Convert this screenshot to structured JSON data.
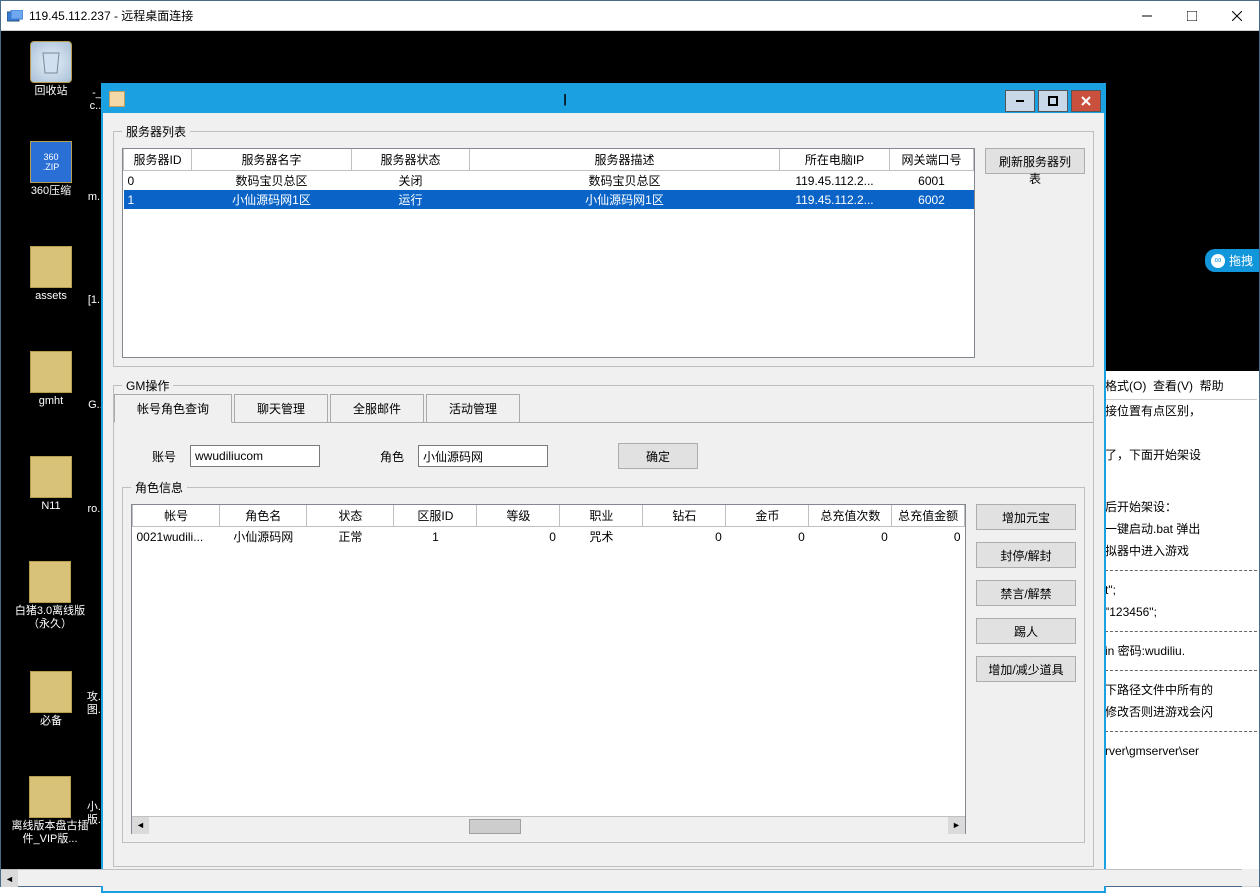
{
  "rdp": {
    "title": "119.45.112.237 - 远程桌面连接"
  },
  "desktop": {
    "recycle": "回收站",
    "zip": "360压缩",
    "assets": "assets",
    "gmht": "gmht",
    "n11": "N11",
    "pig": "白猪3.0离线版（永久）",
    "must": "必备",
    "offline": "离线版本盘古插件_VIP版...",
    "col2a": "-_c...",
    "col2b": "m...",
    "col2c": "[1...",
    "col2d": "G...",
    "col2e": "ro...",
    "col2f": "攻...\n图...",
    "col2g": "小...\n版..."
  },
  "gm": {
    "titlebar_char": "|",
    "server_list_legend": "服务器列表",
    "refresh_btn": "刷新服务器列表",
    "server_cols": {
      "c0": "服务器ID",
      "c1": "服务器名字",
      "c2": "服务器状态",
      "c3": "服务器描述",
      "c4": "所在电脑IP",
      "c5": "网关端口号"
    },
    "server_rows": [
      {
        "id": "0",
        "name": "数码宝贝总区",
        "status": "关闭",
        "desc": "数码宝贝总区",
        "ip": "119.45.112.2...",
        "port": "6001"
      },
      {
        "id": "1",
        "name": "小仙源码网1区",
        "status": "运行",
        "desc": "小仙源码网1区",
        "ip": "119.45.112.2...",
        "port": "6002"
      }
    ],
    "gm_ops_legend": "GM操作",
    "tabs": {
      "t0": "帐号角色查询",
      "t1": "聊天管理",
      "t2": "全服邮件",
      "t3": "活动管理"
    },
    "query": {
      "account_label": "账号",
      "account_value": "wwudiliucom",
      "role_label": "角色",
      "role_value": "小仙源码网",
      "confirm": "确定"
    },
    "role_legend": "角色信息",
    "role_cols": {
      "c0": "帐号",
      "c1": "角色名",
      "c2": "状态",
      "c3": "区服ID",
      "c4": "等级",
      "c5": "职业",
      "c6": "钻石",
      "c7": "金币",
      "c8": "总充值次数",
      "c9": "总充值金额"
    },
    "role_rows": [
      {
        "acct": "0021wudili...",
        "name": "小仙源码网",
        "status": "正常",
        "zone": "1",
        "level": "0",
        "job": "咒术",
        "diamond": "0",
        "gold": "0",
        "recharge_cnt": "0",
        "recharge_amt": "0"
      }
    ],
    "side_btns": {
      "b0": "增加元宝",
      "b1": "封停/解封",
      "b2": "禁言/解禁",
      "b3": "踢人",
      "b4": "增加/减少道具"
    }
  },
  "float_tag": "拖拽",
  "behind": {
    "menu_format": "格式(O)",
    "menu_view": "查看(V)",
    "menu_help": "帮助",
    "l1": "接位置有点区别，",
    "l2": "了，下面开始架设",
    "l3": "后开始架设：",
    "l4": "一键启动.bat 弹出",
    "l5": "拟器中进入游戏",
    "l6": "t\";",
    "l7": "\"123456\";",
    "l8": "in  密码:wudiliu.",
    "l9": "下路径文件中所有的",
    "l10": "修改否则进游戏会闪",
    "l11": "rver\\gmserver\\ser"
  }
}
